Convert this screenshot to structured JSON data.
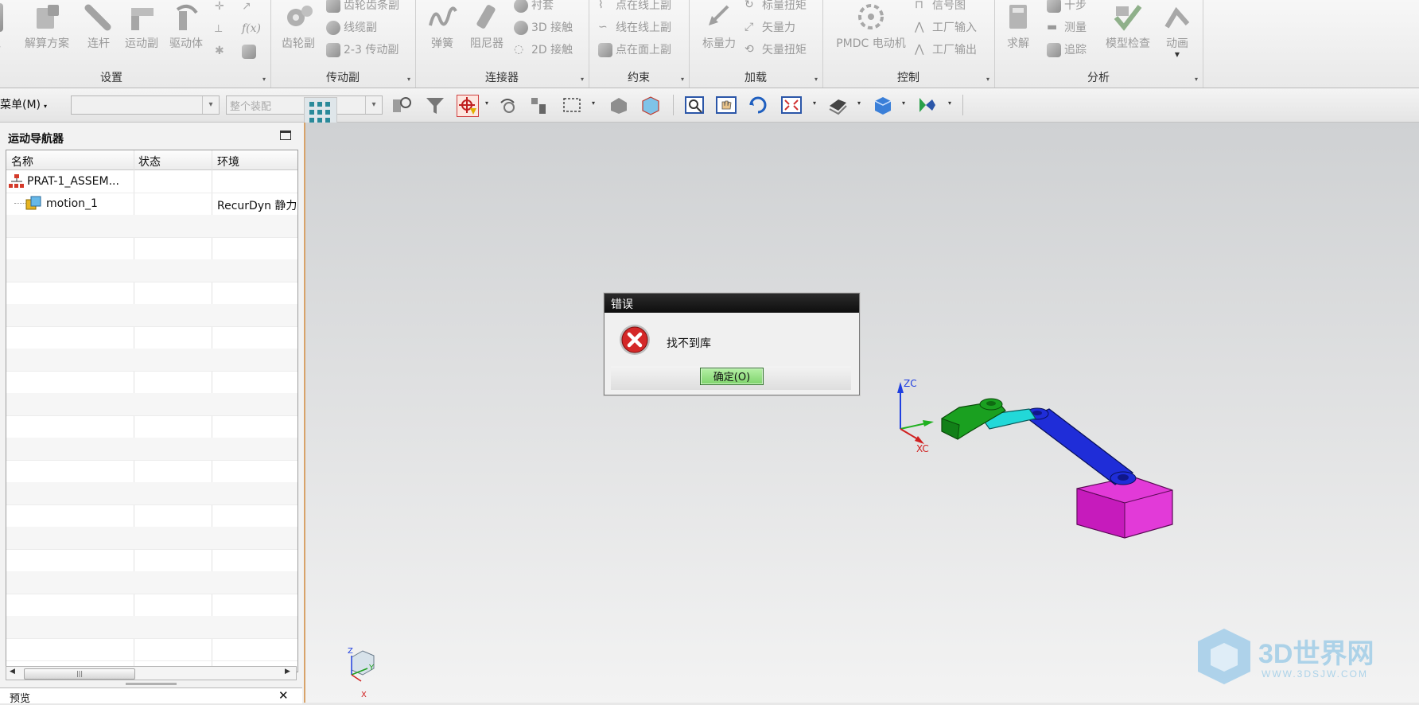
{
  "ribbon": {
    "groups": {
      "setup": "设置",
      "couplers": "传动副",
      "connectors": "连接器",
      "constraints": "约束",
      "loads": "加载",
      "control": "控制",
      "analysis": "分析"
    },
    "setup": {
      "environment_partial": "境",
      "solution": "解算方案",
      "link": "连杆",
      "joint": "运动副",
      "driver": "驱动体",
      "fx": "f(x)"
    },
    "couplers": {
      "gear": "齿轮副",
      "rack_pinion": "齿轮齿条副",
      "cable": "线缆副",
      "two_three": "2-3 传动副"
    },
    "connectors": {
      "spring": "弹簧",
      "damper": "阻尼器",
      "bushing": "衬套",
      "contact_3d": "3D 接触",
      "contact_2d": "2D 接触"
    },
    "constraints": {
      "pt_on_curve": "点在线上副",
      "curve_on_curve": "线在线上副",
      "pt_on_surface": "点在面上副"
    },
    "loads": {
      "scalar_force": "标量力",
      "scalar_torque": "标量扭矩",
      "vector_force": "矢量力",
      "vector_torque": "矢量扭矩"
    },
    "control": {
      "pmdc": "PMDC 电动机",
      "signal_chart": "信号图",
      "plant_input": "工厂输入",
      "plant_output": "工厂输出"
    },
    "analysis": {
      "solve": "求解",
      "step": "十步",
      "measure": "测量",
      "trace": "追踪",
      "model_check": "模型检查",
      "animation": "动画"
    }
  },
  "toolbar": {
    "menu_label": "菜单(M)",
    "assembly_scope": "整个装配"
  },
  "navigator": {
    "title": "运动导航器",
    "columns": [
      "名称",
      "状态",
      "环境"
    ],
    "rows": [
      {
        "name": "PRAT-1_ASSEM...",
        "status": "",
        "env": ""
      },
      {
        "name": "motion_1",
        "status": "",
        "env": "RecurDyn 静力"
      }
    ],
    "preview_label": "预览",
    "close_glyph": "✕"
  },
  "dialog": {
    "title": "错误",
    "message": "找不到库",
    "ok_label": "确定(O)"
  },
  "viewport": {
    "axis_zc": "ZC",
    "axis_xc": "XC",
    "tri_z": "Z",
    "tri_y": "Y",
    "tri_x": "X"
  },
  "watermark": {
    "text": "3D世界网",
    "sub": "WWW.3DSJW.COM"
  }
}
